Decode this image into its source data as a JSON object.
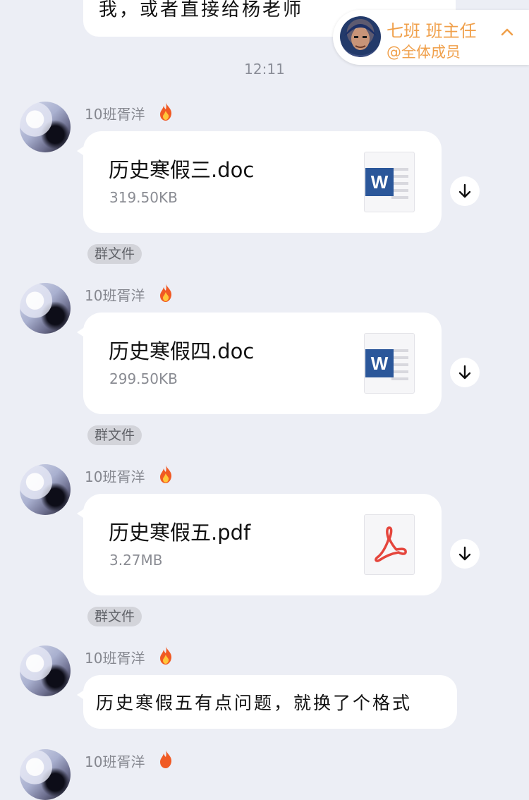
{
  "top_message": {
    "text": "我，或者直接给杨老师"
  },
  "mention_banner": {
    "name": "七班  班主任",
    "subtitle": "@全体成员"
  },
  "time_divider": "12:11",
  "messages": [
    {
      "sender": "10班胥洋",
      "type": "file",
      "file_name": "历史寒假三.doc",
      "file_size": "319.50KB",
      "file_icon": "word-icon",
      "tag": "群文件"
    },
    {
      "sender": "10班胥洋",
      "type": "file",
      "file_name": "历史寒假四.doc",
      "file_size": "299.50KB",
      "file_icon": "word-icon",
      "tag": "群文件"
    },
    {
      "sender": "10班胥洋",
      "type": "file",
      "file_name": "历史寒假五.pdf",
      "file_size": "3.27MB",
      "file_icon": "pdf-icon",
      "tag": "群文件"
    },
    {
      "sender": "10班胥洋",
      "type": "text",
      "text": "历史寒假五有点问题，就换了个格式"
    },
    {
      "sender": "10班胥洋"
    }
  ],
  "colors": {
    "background": "#eceef5",
    "mention_accent": "#f0a04b",
    "word_blue": "#2b579a",
    "pdf_red": "#e5453c"
  }
}
